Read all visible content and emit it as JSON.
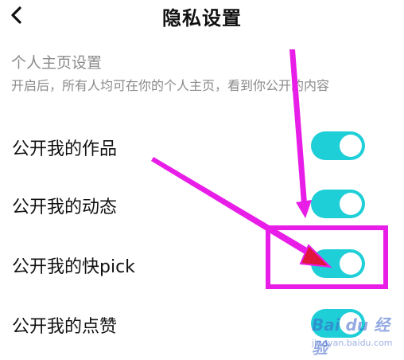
{
  "header": {
    "title": "隐私设置",
    "back_icon": "chevron-left-icon"
  },
  "section": {
    "title": "个人主页设置",
    "description": "开启后，所有人均可在你的个人主页，看到你公开的内容"
  },
  "settings": [
    {
      "label": "公开我的作品",
      "enabled": true
    },
    {
      "label": "公开我的动态",
      "enabled": true
    },
    {
      "label": "公开我的快pick",
      "enabled": true
    },
    {
      "label": "公开我的点赞",
      "enabled": true
    }
  ],
  "colors": {
    "toggle_on": "#1ecfd8",
    "annotation": "#e81ee8",
    "arrow_head": "#e0163a"
  },
  "watermark": {
    "logo": "Bai du 经验",
    "sub": "jingyan.baidu.com"
  }
}
